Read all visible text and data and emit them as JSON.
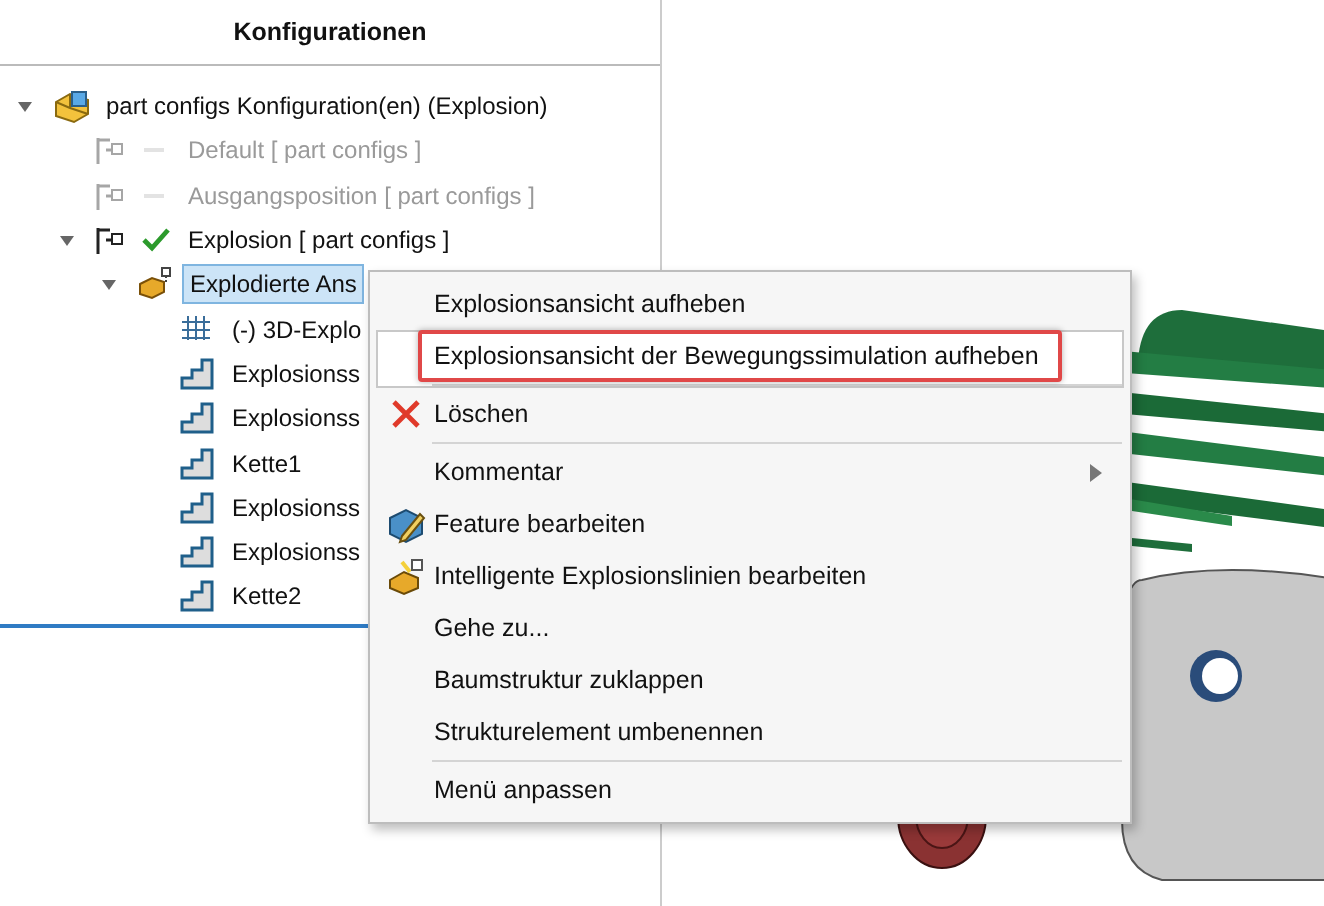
{
  "panel": {
    "title": "Konfigurationen"
  },
  "tree": [
    {
      "label": "part configs Konfiguration(en)  (Explosion)",
      "kind": "root",
      "expanded": true,
      "selected": false,
      "disabled": false,
      "children": [
        {
          "label": "Default [ part configs ]",
          "kind": "config",
          "selected": false,
          "disabled": true,
          "active": false
        },
        {
          "label": "Ausgangsposition [ part configs ]",
          "kind": "config",
          "selected": false,
          "disabled": true,
          "active": false
        },
        {
          "label": "Explosion [ part configs ]",
          "kind": "config",
          "expanded": true,
          "selected": false,
          "disabled": false,
          "active": true,
          "children": [
            {
              "label": "Explodierte Ans",
              "kind": "explode",
              "expanded": true,
              "selected": true,
              "disabled": false,
              "children": [
                {
                  "label": "(-) 3D-Explo",
                  "kind": "sketch",
                  "selected": false,
                  "disabled": false
                },
                {
                  "label": "Explosionss",
                  "kind": "step",
                  "selected": false,
                  "disabled": false
                },
                {
                  "label": "Explosionss",
                  "kind": "step",
                  "selected": false,
                  "disabled": false
                },
                {
                  "label": "Kette1",
                  "kind": "step",
                  "selected": false,
                  "disabled": false
                },
                {
                  "label": "Explosionss",
                  "kind": "step",
                  "selected": false,
                  "disabled": false
                },
                {
                  "label": "Explosionss",
                  "kind": "step",
                  "selected": false,
                  "disabled": false
                },
                {
                  "label": "Kette2",
                  "kind": "step",
                  "selected": false,
                  "disabled": false
                }
              ]
            }
          ]
        }
      ]
    }
  ],
  "context_menu": {
    "items": [
      {
        "label": "Explosionsansicht aufheben",
        "kind": "plain",
        "selected": false,
        "highlighted": false,
        "submenu": false,
        "separator_after": false
      },
      {
        "label": "Explosionsansicht der Bewegungssimulation aufheben",
        "kind": "plain",
        "selected": true,
        "highlighted": true,
        "submenu": false,
        "separator_after": true
      },
      {
        "label": "Löschen",
        "kind": "delete",
        "selected": false,
        "highlighted": false,
        "submenu": false,
        "separator_after": true
      },
      {
        "label": "Kommentar",
        "kind": "plain",
        "selected": false,
        "highlighted": false,
        "submenu": true,
        "separator_after": false
      },
      {
        "label": "Feature bearbeiten",
        "kind": "feature",
        "selected": false,
        "highlighted": false,
        "submenu": false,
        "separator_after": false
      },
      {
        "label": "Intelligente Explosionslinien bearbeiten",
        "kind": "lines",
        "selected": false,
        "highlighted": false,
        "submenu": false,
        "separator_after": false
      },
      {
        "label": "Gehe zu...",
        "kind": "plain",
        "selected": false,
        "highlighted": false,
        "submenu": false,
        "separator_after": false
      },
      {
        "label": "Baumstruktur zuklappen",
        "kind": "plain",
        "selected": false,
        "highlighted": false,
        "submenu": false,
        "separator_after": false
      },
      {
        "label": "Strukturelement umbenennen",
        "kind": "plain",
        "selected": false,
        "highlighted": false,
        "submenu": false,
        "separator_after": true
      },
      {
        "label": "Menü anpassen",
        "kind": "plain",
        "selected": false,
        "highlighted": false,
        "submenu": false,
        "separator_after": false
      }
    ]
  }
}
